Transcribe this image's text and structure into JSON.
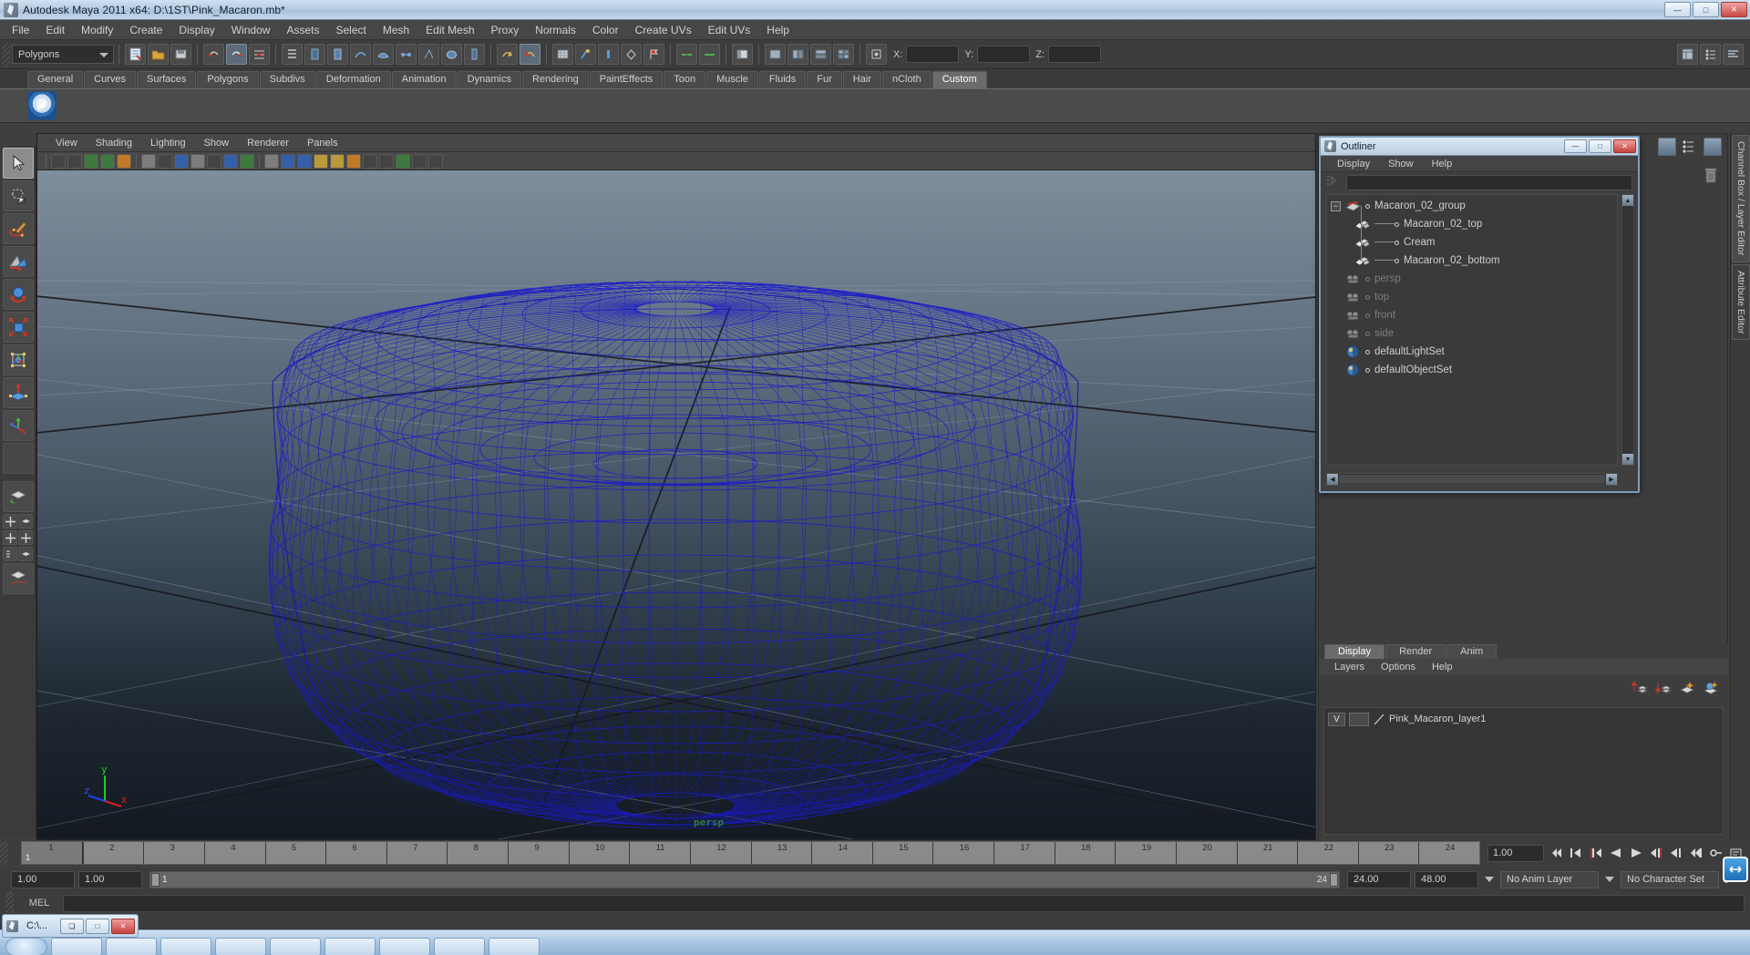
{
  "window": {
    "title": "Autodesk Maya 2011 x64: D:\\1ST\\Pink_Macaron.mb*",
    "minimize": "—",
    "maximize": "□",
    "close": "✕"
  },
  "menubar": {
    "items": [
      "File",
      "Edit",
      "Modify",
      "Create",
      "Display",
      "Window",
      "Assets",
      "Select",
      "Mesh",
      "Edit Mesh",
      "Proxy",
      "Normals",
      "Color",
      "Create UVs",
      "Edit UVs",
      "Help"
    ]
  },
  "statusline": {
    "selection_mode": "Polygons",
    "x_label": "X:",
    "y_label": "Y:",
    "z_label": "Z:",
    "x_value": "",
    "y_value": "",
    "z_value": ""
  },
  "shelf": {
    "tabs": [
      "General",
      "Curves",
      "Surfaces",
      "Polygons",
      "Subdivs",
      "Deformation",
      "Animation",
      "Dynamics",
      "Rendering",
      "PaintEffects",
      "Toon",
      "Muscle",
      "Fluids",
      "Fur",
      "Hair",
      "nCloth",
      "Custom"
    ],
    "active_tab": "Custom",
    "button_glyph": "✔"
  },
  "viewport": {
    "menus": [
      "View",
      "Shading",
      "Lighting",
      "Show",
      "Renderer",
      "Panels"
    ],
    "camera_label": "persp",
    "axis": {
      "x": "x",
      "y": "y",
      "z": "z"
    },
    "wireframe_color": "#1b1bc8"
  },
  "outliner": {
    "title": "Outliner",
    "menus": [
      "Display",
      "Show",
      "Help"
    ],
    "search_value": "",
    "minimize": "—",
    "maximize": "□",
    "close": "✕",
    "expand_glyph": "−",
    "items": [
      {
        "label": "Macaron_02_group",
        "depth": 0,
        "icon": "transform-icon",
        "dim": false,
        "expandable": true
      },
      {
        "label": "Macaron_02_top",
        "depth": 1,
        "icon": "mesh-icon",
        "dim": false,
        "expandable": false
      },
      {
        "label": "Cream",
        "depth": 1,
        "icon": "mesh-icon",
        "dim": false,
        "expandable": false
      },
      {
        "label": "Macaron_02_bottom",
        "depth": 1,
        "icon": "mesh-icon",
        "dim": false,
        "expandable": false
      },
      {
        "label": "persp",
        "depth": 0,
        "icon": "camera-icon",
        "dim": true,
        "expandable": false
      },
      {
        "label": "top",
        "depth": 0,
        "icon": "camera-icon",
        "dim": true,
        "expandable": false
      },
      {
        "label": "front",
        "depth": 0,
        "icon": "camera-icon",
        "dim": true,
        "expandable": false
      },
      {
        "label": "side",
        "depth": 0,
        "icon": "camera-icon",
        "dim": true,
        "expandable": false
      },
      {
        "label": "defaultLightSet",
        "depth": 0,
        "icon": "set-icon",
        "dim": false,
        "expandable": false
      },
      {
        "label": "defaultObjectSet",
        "depth": 0,
        "icon": "set-icon",
        "dim": false,
        "expandable": false
      }
    ],
    "scroll_up": "▲",
    "scroll_down": "▼",
    "scroll_left": "◀",
    "scroll_right": "▶"
  },
  "layer_editor": {
    "tabs": [
      "Display",
      "Render",
      "Anim"
    ],
    "active_tab": "Display",
    "menus": [
      "Layers",
      "Options",
      "Help"
    ],
    "layers": [
      {
        "visibility": "V",
        "playback": "",
        "name": "Pink_Macaron_layer1"
      }
    ]
  },
  "right_tabs": [
    "Channel Box / Layer Editor",
    "Attribute Editor"
  ],
  "timeline": {
    "ticks": [
      1,
      2,
      3,
      4,
      5,
      6,
      7,
      8,
      9,
      10,
      11,
      12,
      13,
      14,
      15,
      16,
      17,
      18,
      19,
      20,
      21,
      22,
      23,
      24
    ],
    "current_frame": "1",
    "current_time_field": "1.00",
    "playback_buttons": [
      "⏮",
      "⏪",
      "◁",
      "◀",
      "▶",
      "▷",
      "⏩",
      "⏭"
    ]
  },
  "range_slider": {
    "anim_start": "1.00",
    "range_start": "1.00",
    "bar_start": "1",
    "bar_end": "24",
    "range_end": "24.00",
    "anim_end": "48.00",
    "anim_layer": "No Anim Layer",
    "character_set": "No Character Set"
  },
  "command_line": {
    "label": "MEL",
    "value": ""
  },
  "taskbar": {
    "window_title": "C:\\...",
    "minimize": "❏",
    "maximize": "□",
    "close": "✕"
  }
}
